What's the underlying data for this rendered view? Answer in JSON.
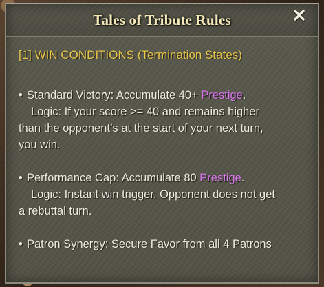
{
  "window": {
    "title": "Tales of Tribute Rules",
    "close_symbol": "✕"
  },
  "section": {
    "heading": "[1] WIN CONDITIONS (Termination States)"
  },
  "rules": [
    {
      "bullet": "•",
      "line1_prefix": "Standard Victory: Accumulate 40+ ",
      "line1_highlight": "Prestige",
      "line1_suffix": ".",
      "logic_line1": "Logic: If your score >= 40 and remains higher",
      "logic_line2": "than the opponent’s at the start of your next turn,",
      "logic_line3": "you win."
    },
    {
      "bullet": "•",
      "line1_prefix": "Performance Cap: Accumulate 80 ",
      "line1_highlight": "Prestige",
      "line1_suffix": ".",
      "logic_line1": "Logic: Instant win trigger. Opponent does not get",
      "logic_line2": "a rebuttal turn."
    },
    {
      "bullet": "•",
      "line1_prefix": "Patron Synergy: Secure Favor from all 4 Patrons"
    }
  ],
  "colors": {
    "heading": "#e8c64a",
    "highlight": "#d978ec",
    "title": "#f3e7b8",
    "body_text": "#eeeadc"
  }
}
